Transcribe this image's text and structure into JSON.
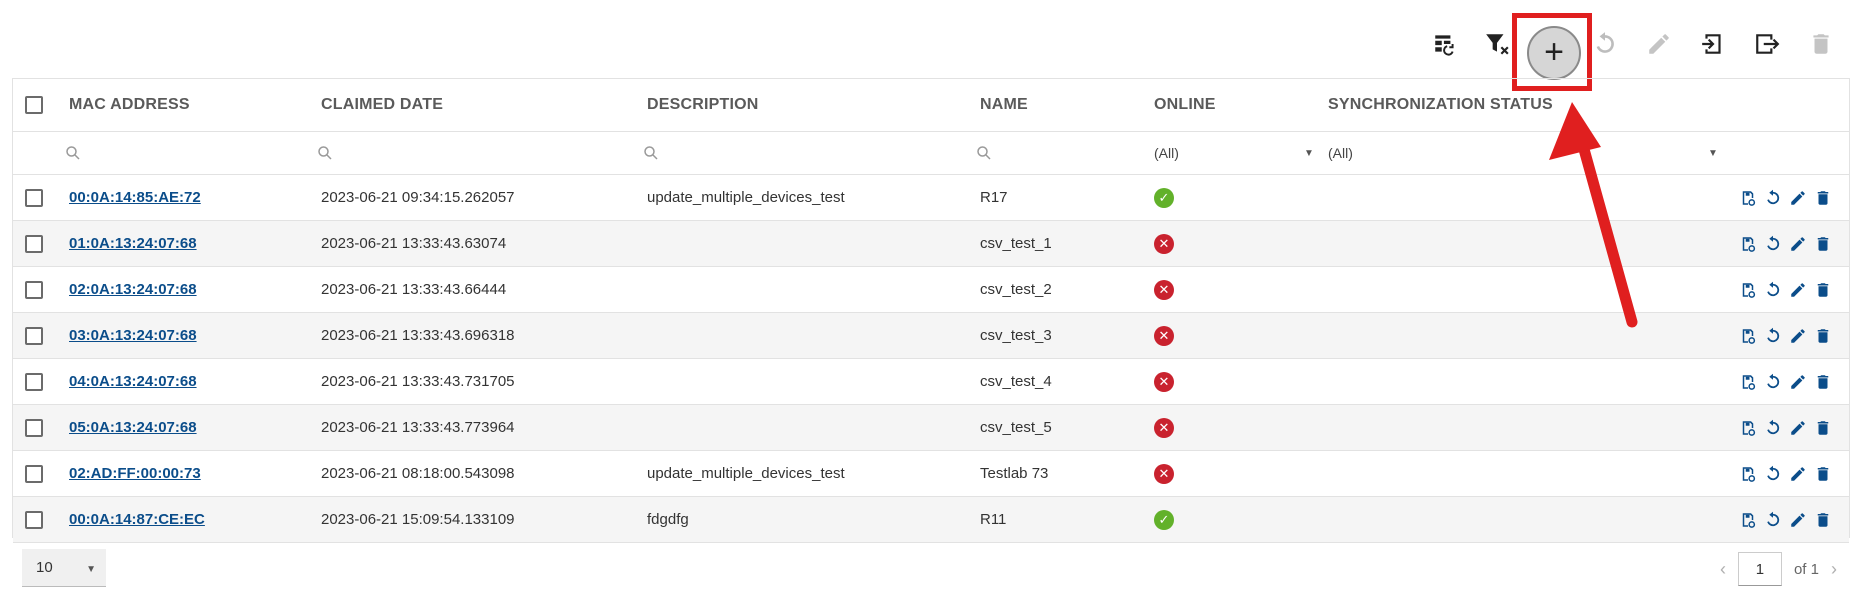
{
  "toolbar": {
    "add_label": "+"
  },
  "columns": {
    "mac": "MAC ADDRESS",
    "claimed": "CLAIMED DATE",
    "description": "DESCRIPTION",
    "name": "NAME",
    "online": "ONLINE",
    "sync": "SYNCHRONIZATION STATUS"
  },
  "filters": {
    "online_value": "(All)",
    "sync_value": "(All)"
  },
  "rows": [
    {
      "mac": "00:0A:14:85:AE:72",
      "claimed": "2023-06-21 09:34:15.262057",
      "description": "update_multiple_devices_test",
      "name": "R17",
      "online": "online"
    },
    {
      "mac": "01:0A:13:24:07:68",
      "claimed": "2023-06-21 13:33:43.63074",
      "description": "",
      "name": "csv_test_1",
      "online": "offline"
    },
    {
      "mac": "02:0A:13:24:07:68",
      "claimed": "2023-06-21 13:33:43.66444",
      "description": "",
      "name": "csv_test_2",
      "online": "offline"
    },
    {
      "mac": "03:0A:13:24:07:68",
      "claimed": "2023-06-21 13:33:43.696318",
      "description": "",
      "name": "csv_test_3",
      "online": "offline"
    },
    {
      "mac": "04:0A:13:24:07:68",
      "claimed": "2023-06-21 13:33:43.731705",
      "description": "",
      "name": "csv_test_4",
      "online": "offline"
    },
    {
      "mac": "05:0A:13:24:07:68",
      "claimed": "2023-06-21 13:33:43.773964",
      "description": "",
      "name": "csv_test_5",
      "online": "offline"
    },
    {
      "mac": "02:AD:FF:00:00:73",
      "claimed": "2023-06-21 08:18:00.543098",
      "description": "update_multiple_devices_test",
      "name": "Testlab 73",
      "online": "offline"
    },
    {
      "mac": "00:0A:14:87:CE:EC",
      "claimed": "2023-06-21 15:09:54.133109",
      "description": "fdgdfg",
      "name": "R11",
      "online": "online"
    }
  ],
  "pager": {
    "page_size": "10",
    "current_page": "1",
    "of_label": "of 1"
  },
  "colors": {
    "link": "#0b4d8a",
    "online": "#62b12a",
    "offline": "#c9222e",
    "highlight": "#e01f1f"
  }
}
